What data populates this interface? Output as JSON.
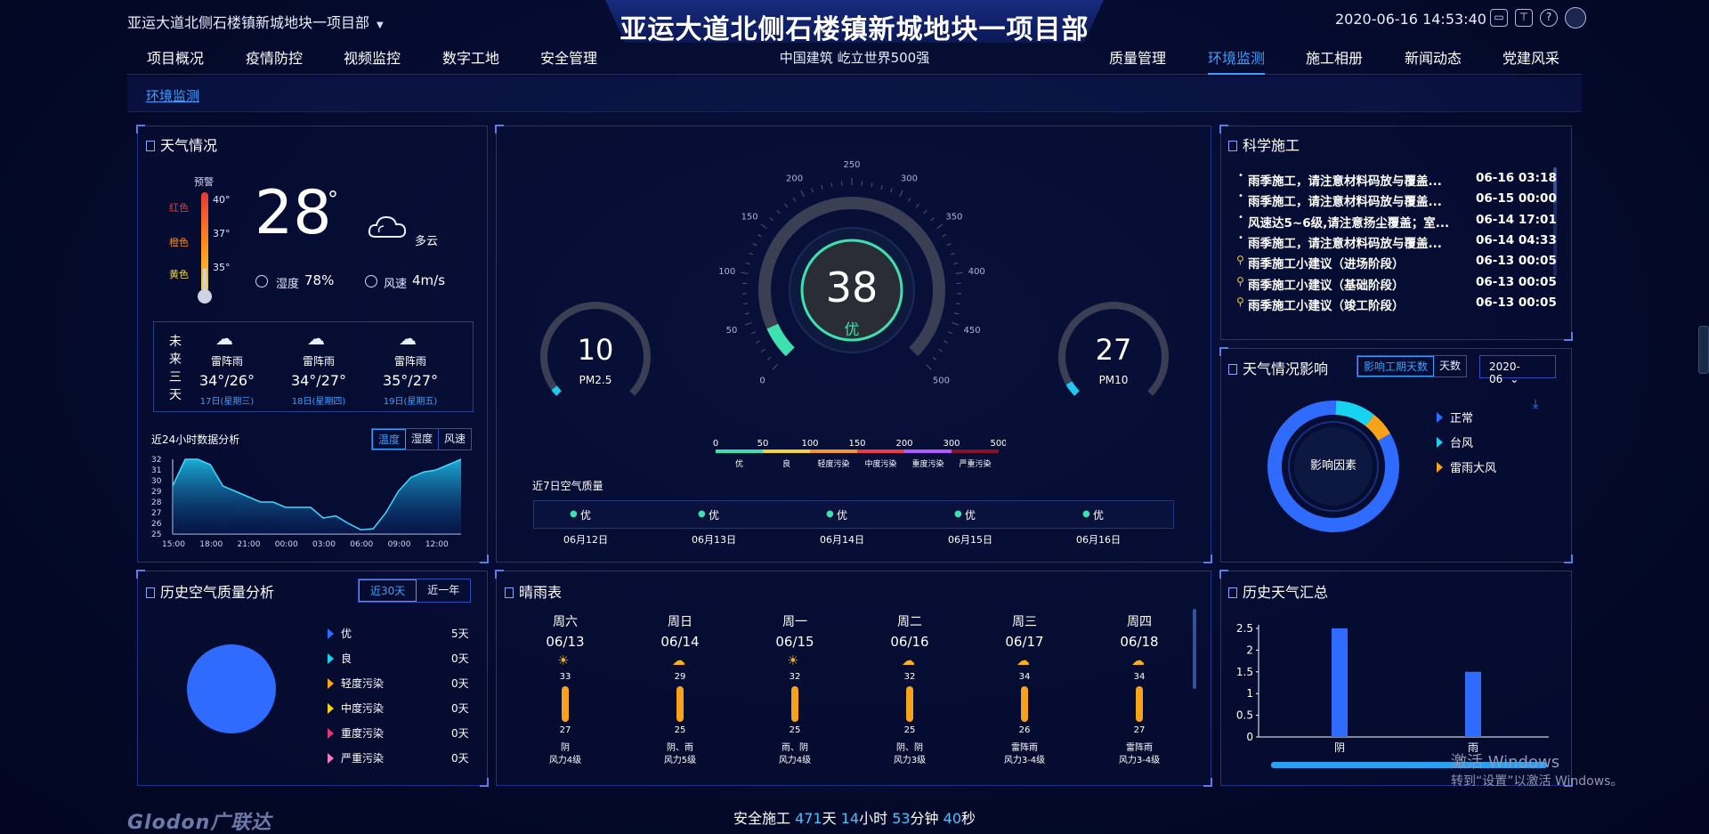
{
  "header": {
    "project_select": "亚运大道北侧石楼镇新城地块一项目部",
    "title": "亚运大道北侧石楼镇新城地块一项目部",
    "subtitle": "中国建筑 屹立世界500强",
    "datetime": "2020-06-16 14:53:40",
    "icons": [
      "monitor-icon",
      "shirt-icon",
      "help-icon",
      "user-avatar-icon"
    ]
  },
  "nav": {
    "left": [
      "项目概况",
      "疫情防控",
      "视频监控",
      "数字工地",
      "安全管理"
    ],
    "right": [
      "质量管理",
      "环境监测",
      "施工相册",
      "新闻动态",
      "党建风采"
    ],
    "active": "环境监测"
  },
  "breadcrumb": "环境监测",
  "weather": {
    "title": "天气情况",
    "warning_label": "预警",
    "levels": [
      {
        "label": "红色",
        "temp": "40°",
        "color": "#e53935"
      },
      {
        "label": "橙色",
        "temp": "37°",
        "color": "#ff8a1f"
      },
      {
        "label": "黄色",
        "temp": "35°",
        "color": "#f5d431"
      }
    ],
    "temperature": "28",
    "degree": "°",
    "condition": "多云",
    "humidity_label": "湿度",
    "humidity": "78%",
    "wind_label": "风速",
    "wind": "4m/s",
    "forecast_label": "未来三天",
    "forecast": [
      {
        "cond": "雷阵雨",
        "temp": "34°/26°",
        "date": "17日(星期三)"
      },
      {
        "cond": "雷阵雨",
        "temp": "34°/27°",
        "date": "18日(星期四)"
      },
      {
        "cond": "雷阵雨",
        "temp": "35°/27°",
        "date": "19日(星期五)"
      }
    ],
    "chart_title": "近24小时数据分析",
    "tabs": [
      "温度",
      "湿度",
      "风速"
    ],
    "active_tab": "温度"
  },
  "aqi": {
    "value": "38",
    "level": "优",
    "pm25_value": "10",
    "pm25_label": "PM2.5",
    "pm10_value": "27",
    "pm10_label": "PM10",
    "gauge_ticks": [
      "0",
      "50",
      "100",
      "150",
      "200",
      "250",
      "300",
      "350",
      "400",
      "450",
      "500"
    ],
    "scale_numbers": [
      "0",
      "50",
      "100",
      "150",
      "200",
      "300",
      "500"
    ],
    "scale_labels": [
      "优",
      "良",
      "轻度污染",
      "中度污染",
      "重度污染",
      "严重污染"
    ],
    "scale_colors": [
      "#3fe0b0",
      "#f3d53a",
      "#f59a2a",
      "#ec3a4a",
      "#b05cff",
      "#8a1226"
    ],
    "week_title": "近7日空气质量",
    "week": [
      {
        "status": "优",
        "date": "06月12日"
      },
      {
        "status": "优",
        "date": "06月13日"
      },
      {
        "status": "优",
        "date": "06月14日"
      },
      {
        "status": "优",
        "date": "06月15日"
      },
      {
        "status": "优",
        "date": "06月16日"
      }
    ]
  },
  "science": {
    "title": "科学施工",
    "items": [
      {
        "text": "雨季施工，请注意材料码放与覆盖...",
        "time": "06-16 03:18",
        "icon": "dot"
      },
      {
        "text": "雨季施工，请注意材料码放与覆盖...",
        "time": "06-15 00:00",
        "icon": "dot"
      },
      {
        "text": "风速达5~6级,请注意扬尘覆盖；室...",
        "time": "06-14 17:01",
        "icon": "dot"
      },
      {
        "text": "雨季施工，请注意材料码放与覆盖...",
        "time": "06-14 04:33",
        "icon": "dot"
      },
      {
        "text": "雨季施工小建议（进场阶段）",
        "time": "06-13 00:05",
        "icon": "pin"
      },
      {
        "text": "雨季施工小建议（基础阶段）",
        "time": "06-13 00:05",
        "icon": "pin"
      },
      {
        "text": "雨季施工小建议（竣工阶段）",
        "time": "06-13 00:05",
        "icon": "pin"
      }
    ]
  },
  "impact": {
    "title": "天气情况影响",
    "tabs": [
      "影响工期天数",
      "天数"
    ],
    "month": "2020-06",
    "center_label": "影响因素",
    "legend": [
      {
        "label": "正常",
        "color": "#2f6bff"
      },
      {
        "label": "台风",
        "color": "#17d3f0"
      },
      {
        "label": "雷雨大风",
        "color": "#f6a21a"
      }
    ]
  },
  "history_air": {
    "title": "历史空气质量分析",
    "tabs": [
      "近30天",
      "近一年"
    ],
    "items": [
      {
        "label": "优",
        "value": "5天",
        "color": "#2f6bff"
      },
      {
        "label": "良",
        "value": "0天",
        "color": "#17d3f0"
      },
      {
        "label": "轻度污染",
        "value": "0天",
        "color": "#f6a21a"
      },
      {
        "label": "中度污染",
        "value": "0天",
        "color": "#f6d21a"
      },
      {
        "label": "重度污染",
        "value": "0天",
        "color": "#e0367a"
      },
      {
        "label": "严重污染",
        "value": "0天",
        "color": "#f07ac8"
      }
    ]
  },
  "forecast_week": {
    "title": "晴雨表",
    "days": [
      {
        "weekday": "周六",
        "date": "06/13",
        "high": "33",
        "low": "27",
        "cond": "阴",
        "wind": "风力4级",
        "icon": "sun"
      },
      {
        "weekday": "周日",
        "date": "06/14",
        "high": "29",
        "low": "25",
        "cond": "阴、雨",
        "wind": "风力5级",
        "icon": "rain"
      },
      {
        "weekday": "周一",
        "date": "06/15",
        "high": "32",
        "low": "25",
        "cond": "雨、阴",
        "wind": "风力4级",
        "icon": "sun"
      },
      {
        "weekday": "周二",
        "date": "06/16",
        "high": "32",
        "low": "25",
        "cond": "阴、阴",
        "wind": "风力3级",
        "icon": "cloud"
      },
      {
        "weekday": "周三",
        "date": "06/17",
        "high": "34",
        "low": "26",
        "cond": "雷阵雨",
        "wind": "风力3-4级",
        "icon": "rain"
      },
      {
        "weekday": "周四",
        "date": "06/18",
        "high": "34",
        "low": "27",
        "cond": "雷阵雨",
        "wind": "风力3-4级",
        "icon": "rain"
      }
    ]
  },
  "history_weather": {
    "title": "历史天气汇总"
  },
  "footer": {
    "prefix": "安全施工",
    "days": "471",
    "days_unit": "天",
    "hours": "14",
    "hours_unit": "小时",
    "minutes": "53",
    "minutes_unit": "分钟",
    "seconds": "40",
    "seconds_unit": "秒",
    "logo": "Glodon广联达"
  },
  "watermark": {
    "line1": "激活 Windows",
    "line2": "转到“设置”以激活 Windows。"
  },
  "chart_data": [
    {
      "type": "area",
      "title": "近24小时数据分析",
      "x": [
        "15:00",
        "16:00",
        "17:00",
        "18:00",
        "19:00",
        "20:00",
        "21:00",
        "22:00",
        "23:00",
        "00:00",
        "01:00",
        "02:00",
        "03:00",
        "04:00",
        "05:00",
        "06:00",
        "07:00",
        "08:00",
        "09:00",
        "10:00",
        "11:00",
        "12:00",
        "13:00",
        "14:00"
      ],
      "y_ticks": [
        "32",
        "31",
        "30",
        "29",
        "28",
        "27",
        "26",
        "25"
      ],
      "xtick_labels": [
        "15:00",
        "18:00",
        "21:00",
        "00:00",
        "03:00",
        "06:00",
        "09:00",
        "12:00"
      ],
      "series": [
        {
          "values": [
            29.5,
            32,
            32,
            31.5,
            29.5,
            29,
            28.5,
            28,
            28,
            27.5,
            27.5,
            27.5,
            26.5,
            26.7,
            26,
            25.4,
            25.5,
            27,
            29,
            30.3,
            30.8,
            31,
            31.5,
            32
          ]
        }
      ],
      "ylim": [
        25,
        32
      ]
    },
    {
      "type": "pie",
      "title": "天气情况影响",
      "categories": [
        "正常",
        "台风",
        "雷雨大风"
      ],
      "values": [
        84,
        10,
        6
      ]
    },
    {
      "type": "pie",
      "title": "历史空气质量分析",
      "categories": [
        "优",
        "良",
        "轻度污染",
        "中度污染",
        "重度污染",
        "严重污染"
      ],
      "values": [
        5,
        0,
        0,
        0,
        0,
        0
      ]
    },
    {
      "type": "bar",
      "title": "历史天气汇总",
      "categories": [
        "阴",
        "雨"
      ],
      "values": [
        2.5,
        1.5
      ],
      "yticks": [
        "0",
        "0.5",
        "1",
        "1.5",
        "2",
        "2.5"
      ],
      "ylim": [
        0,
        2.5
      ]
    }
  ]
}
